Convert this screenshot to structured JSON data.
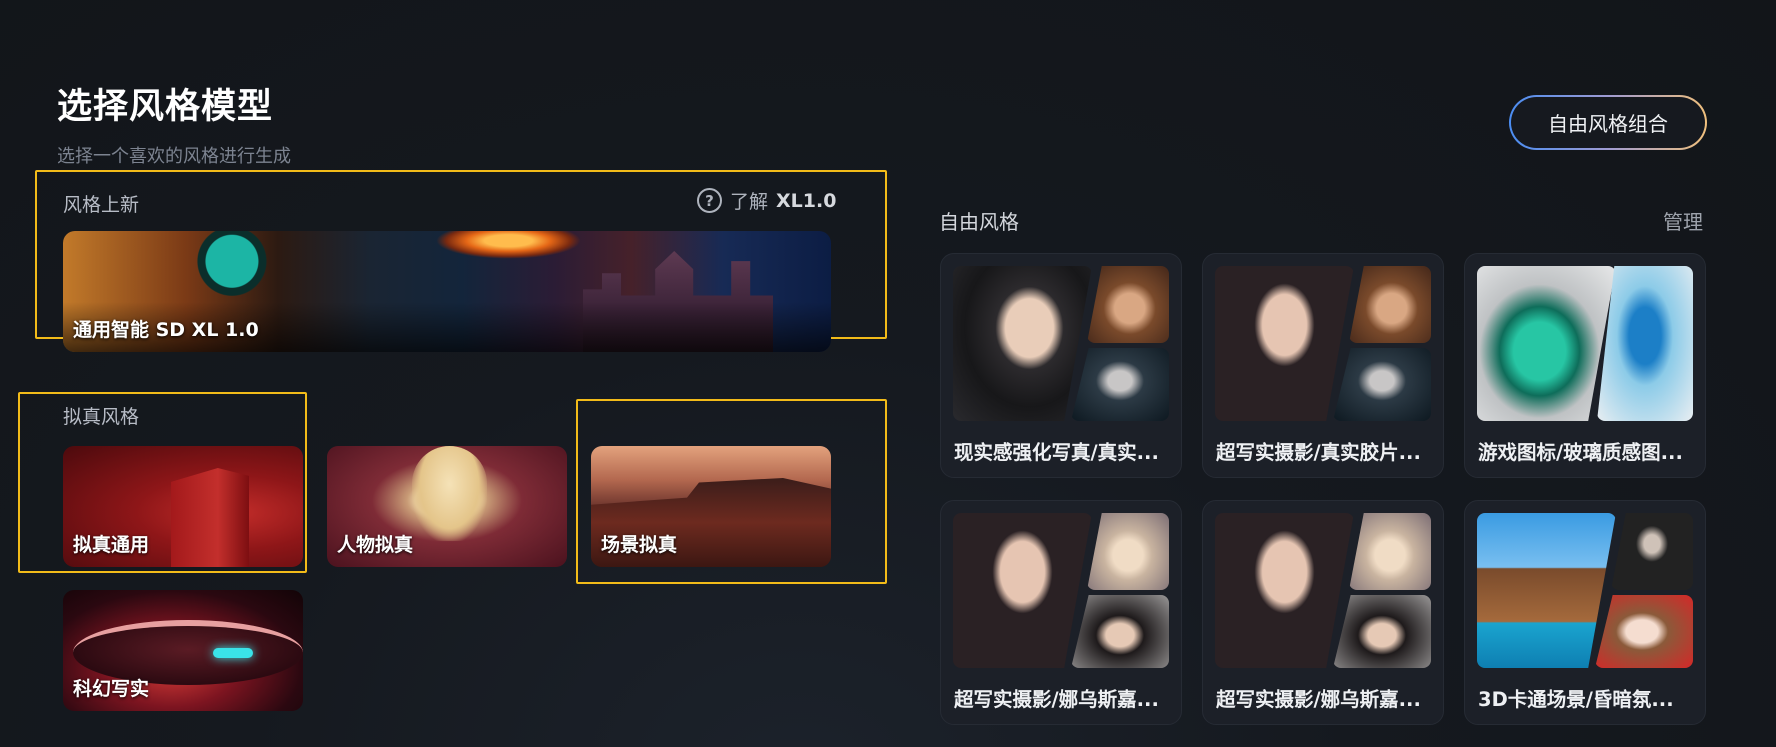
{
  "page": {
    "title": "选择风格模型",
    "subtitle": "选择一个喜欢的风格进行生成"
  },
  "new_styles": {
    "label": "风格上新",
    "learn_prefix": "了解",
    "learn_model": "XL1.0",
    "help_icon": "?",
    "banner_label": "通用智能 SD XL 1.0"
  },
  "realistic": {
    "label": "拟真风格",
    "cards": [
      {
        "label": "拟真通用"
      },
      {
        "label": "人物拟真"
      },
      {
        "label": "场景拟真"
      },
      {
        "label": "科幻写实"
      }
    ]
  },
  "free_style": {
    "label": "自由风格",
    "manage": "管理",
    "combo_button": "自由风格组合",
    "cards": [
      {
        "label": "现实感强化写真/真实..."
      },
      {
        "label": "超写实摄影/真实胶片..."
      },
      {
        "label": "游戏图标/玻璃质感图..."
      },
      {
        "label": "超写实摄影/娜乌斯嘉..."
      },
      {
        "label": "超写实摄影/娜乌斯嘉..."
      },
      {
        "label": "3D卡通场景/昏暗氛..."
      }
    ]
  },
  "colors": {
    "background": "#121519",
    "highlight": "#f2bb19",
    "card_bg": "#1c2028",
    "button_gradient": [
      "#4b8df2",
      "#9f9bd2",
      "#f0c07d"
    ]
  }
}
